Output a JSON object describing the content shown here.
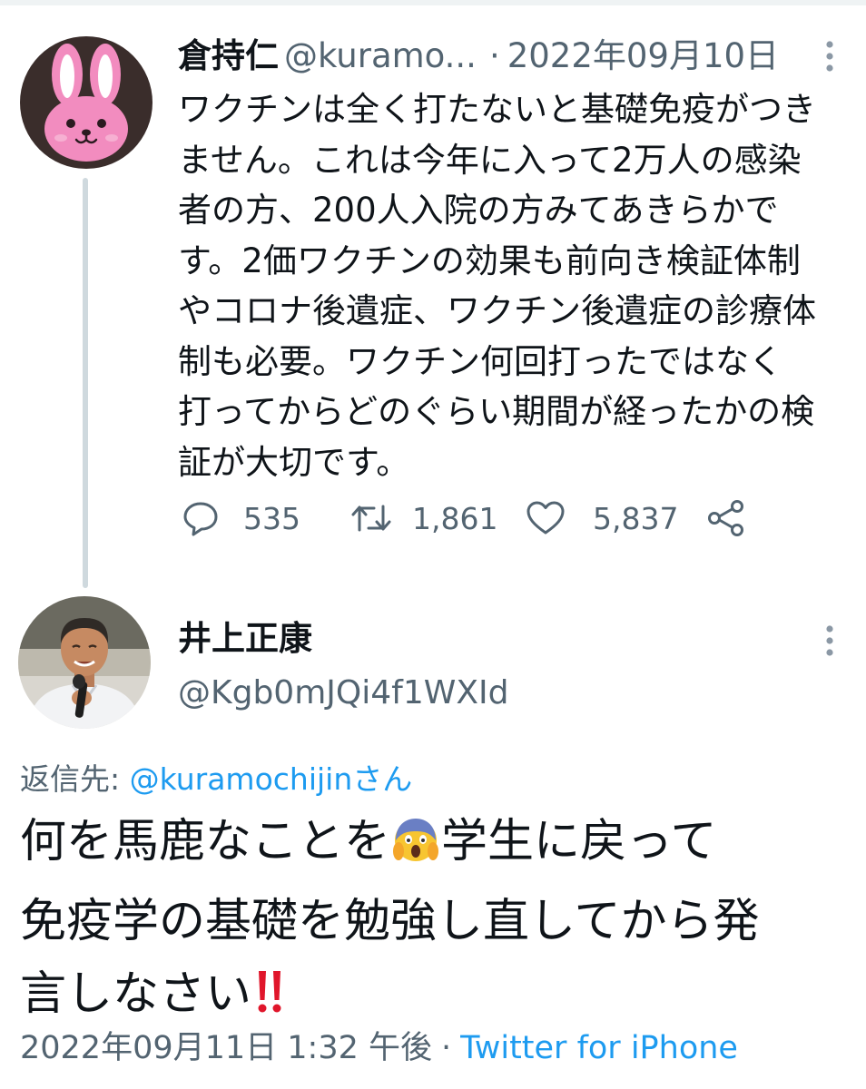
{
  "parent_tweet": {
    "author_name": "倉持仁",
    "author_handle": "@kuramo...",
    "separator": "·",
    "date": "2022年09月10日",
    "avatar_icon": "pink-bunny-avatar",
    "body_lines": [
      "ワクチンは全く打たないと基礎免疫がつき",
      "ません。これは今年に入って2万人の感染",
      "者の方、200人入院の方みてあきらかで",
      "す。2価ワクチンの効果も前向き検証体制",
      "やコロナ後遺症、ワクチン後遺症の診療体",
      "制も必要。ワクチン何回打ったではなく",
      "打ってからどのぐらい期間が経ったかの検",
      "証が大切です。"
    ],
    "stats": {
      "replies": "535",
      "retweets": "1,861",
      "likes": "5,837"
    }
  },
  "reply_tweet": {
    "author_name": "井上正康",
    "author_handle": "@Kgb0mJQi4f1WXId",
    "avatar_icon": "man-with-microphone-avatar",
    "replying_to_prefix": "返信先:",
    "replying_to_mention": "@kuramochijinさん",
    "body_line1_a": "何を馬鹿なことを",
    "body_line1_emoji": "screaming-face-emoji",
    "body_line1_b": "学生に戻って",
    "body_line2": "免疫学の基礎を勉強し直してから発",
    "body_line3": "言しなさい",
    "body_line3_emoji": "double-exclamation-emoji",
    "timestamp": "2022年09月11日 1:32 午後",
    "separator": "·",
    "source": "Twitter for iPhone"
  },
  "colors": {
    "text_primary": "#0f1419",
    "text_secondary": "#536471",
    "link_blue": "#1d9bf0",
    "thread_line": "#cfd9de",
    "exclamation_red": "#e0162b"
  }
}
